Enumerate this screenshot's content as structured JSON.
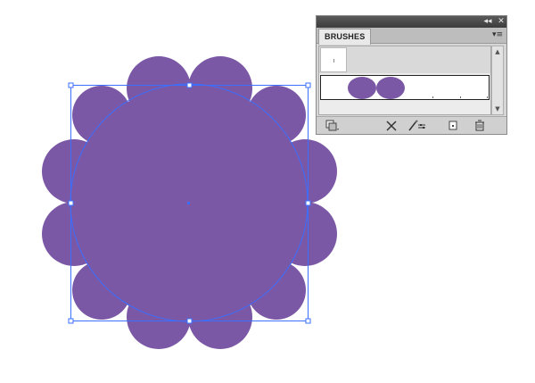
{
  "panel": {
    "tab_label": "BRUSHES",
    "collapse_glyph": "◂◂",
    "close_glyph": "✕",
    "menu_glyph": "▾≡",
    "scroll_up_glyph": "▲",
    "scroll_down_glyph": "▼",
    "brush_row_1": {
      "selected": false
    },
    "brush_row_2": {
      "selected": true
    },
    "bottom_buttons": [
      {
        "name": "brush-libraries-menu",
        "icon": "library-icon"
      },
      {
        "name": "remove-brush-stroke",
        "icon": "remove-stroke-icon"
      },
      {
        "name": "options-of-selected-object",
        "icon": "brush-options-icon"
      },
      {
        "name": "new-brush",
        "icon": "new-icon"
      },
      {
        "name": "delete-brush",
        "icon": "trash-icon"
      }
    ]
  },
  "canvas": {
    "shape_color": "#7b58a6",
    "selection_color": "#3a6fff",
    "background": "#ffffff"
  }
}
